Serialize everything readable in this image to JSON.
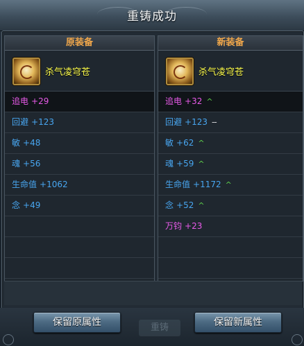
{
  "dialog": {
    "title": "重铸成功"
  },
  "left_panel": {
    "header": "原装备",
    "item_name": "杀气凌穹苍",
    "stats": [
      {
        "name": "追电",
        "value": "+29",
        "color": "magenta"
      },
      {
        "name": "回避",
        "value": "+123",
        "color": "blue"
      },
      {
        "name": "敏",
        "value": "+48",
        "color": "blue"
      },
      {
        "name": "魂",
        "value": "+56",
        "color": "blue"
      },
      {
        "name": "生命值",
        "value": "+1062",
        "color": "blue"
      },
      {
        "name": "念",
        "value": "+49",
        "color": "blue"
      }
    ]
  },
  "right_panel": {
    "header": "新装备",
    "item_name": "杀气凌穹苍",
    "stats": [
      {
        "name": "追电",
        "value": "+32",
        "color": "magenta",
        "change": "^"
      },
      {
        "name": "回避",
        "value": "+123",
        "color": "blue",
        "change": "--"
      },
      {
        "name": "敏",
        "value": "+62",
        "color": "blue",
        "change": "^"
      },
      {
        "name": "魂",
        "value": "+59",
        "color": "blue",
        "change": "^"
      },
      {
        "name": "生命值",
        "value": "+1172",
        "color": "blue",
        "change": "^"
      },
      {
        "name": "念",
        "value": "+52",
        "color": "blue",
        "change": "^"
      },
      {
        "name": "万钧",
        "value": "+23",
        "color": "magenta"
      }
    ]
  },
  "buttons": {
    "keep_old": "保留原属性",
    "keep_new": "保留新属性"
  },
  "background_button": "重铸",
  "colors": {
    "header_text": "#f2a84b",
    "item_name": "#ffff4f",
    "stat_magenta": "#e85ae8",
    "stat_blue": "#48a6f0",
    "increase_arrow": "#5fd24c"
  },
  "icons": {
    "item_icon": "golden-orb-equipment-icon",
    "increase": "up-chevron-icon",
    "unchanged": "double-dash-icon"
  }
}
